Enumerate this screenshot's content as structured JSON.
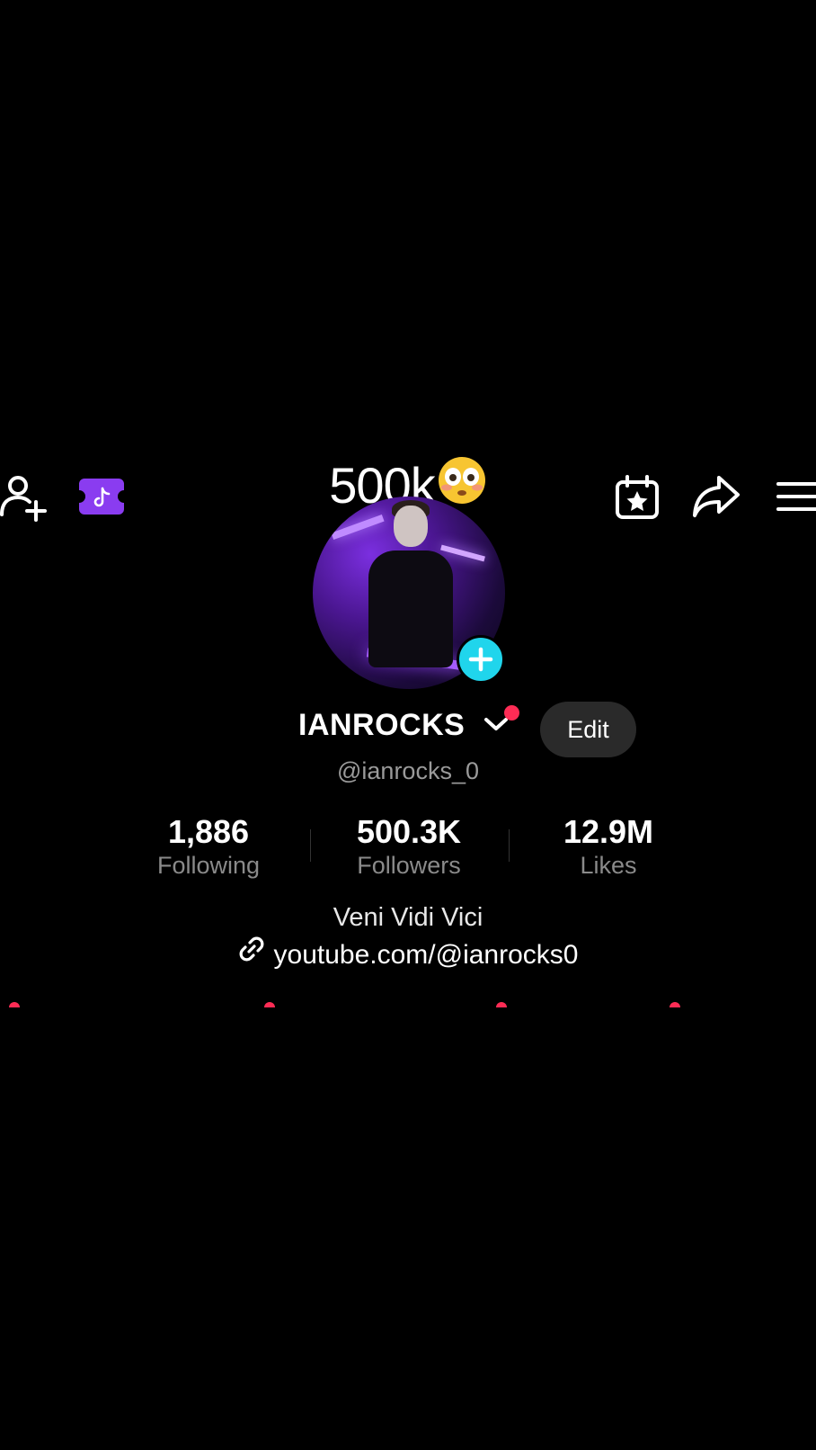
{
  "caption": {
    "text": "500k",
    "emoji": "flushed-face-emoji"
  },
  "topbar": {
    "left_icons": [
      "add-friend-icon",
      "tiktok-ticket-icon"
    ],
    "right_icons": [
      "calendar-star-icon",
      "share-icon",
      "menu-icon"
    ]
  },
  "profile": {
    "display_name": "IANROCKS",
    "edit_label": "Edit",
    "username": "@ianrocks_0",
    "bio": "Veni Vidi Vici",
    "link": "youtube.com/@ianrocks0"
  },
  "stats": [
    {
      "value": "1,886",
      "label": "Following"
    },
    {
      "value": "500.3K",
      "label": "Followers"
    },
    {
      "value": "12.9M",
      "label": "Likes"
    }
  ],
  "colors": {
    "background": "#000000",
    "accent_red": "#fe2c55",
    "accent_cyan": "#20d5ec",
    "ticket_purple": "#8a3cf0",
    "edit_bg": "#2a2a2a"
  }
}
